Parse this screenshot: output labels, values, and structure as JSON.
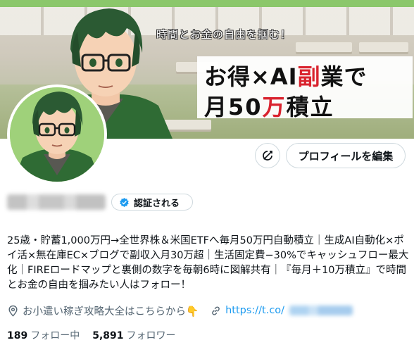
{
  "banner": {
    "tagline": "時間とお金の自由を掴む！",
    "line1_a": "お得×AI",
    "line1_highlight": "副",
    "line1_b": "業で",
    "line2_a": "月50",
    "line2_highlight": "万",
    "line2_b": "積立",
    "highlight_color": "#d9232e"
  },
  "actions": {
    "icon_name": "no-sync-icon",
    "edit_profile_label": "プロフィールを編集"
  },
  "profile": {
    "verify_label": "認証される",
    "bio": "25歳・貯蓄1,000万円→全世界株＆米国ETFへ毎月50万円自動積立｜生成AI自動化×ポイ活×無在庫EC×ブログで副収入月30万超｜生活固定費−30%でキャッシュフロー最大化｜FIREロードマップと裏側の数字を毎朝6時に図解共有｜『毎月＋10万積立』で時間とお金の自由を掴みたい人はフォロー！",
    "location": "お小遣い稼ぎ攻略大全はこちらから👇",
    "link_prefix": "https://t.co/"
  },
  "counts": {
    "following_value": "189",
    "following_label": "フォロー中",
    "followers_value": "5,891",
    "followers_label": "フォロワー"
  },
  "colors": {
    "link": "#1d9bf0",
    "muted": "#536471",
    "verified": "#1d9bf0"
  }
}
